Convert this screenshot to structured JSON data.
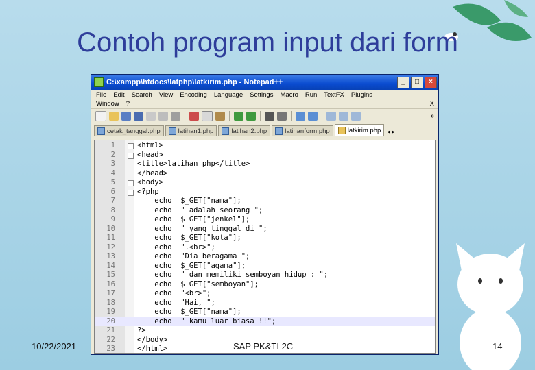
{
  "slide": {
    "title": "Contoh program input dari form",
    "footer_date": "10/22/2021",
    "footer_center": "SAP PK&TI 2C",
    "page_number": "14"
  },
  "window": {
    "title": "C:\\xampp\\htdocs\\latphp\\latkirim.php - Notepad++",
    "buttons": [
      "_",
      "□",
      "×"
    ]
  },
  "menu": {
    "row1": [
      "File",
      "Edit",
      "Search",
      "View",
      "Encoding",
      "Language",
      "Settings",
      "Macro",
      "Run",
      "TextFX",
      "Plugins"
    ],
    "row2": [
      "Window",
      "?"
    ],
    "close": "X",
    "more": "»"
  },
  "tabs": [
    {
      "label": "cetak_tanggal.php",
      "active": false
    },
    {
      "label": "latihan1.php",
      "active": false
    },
    {
      "label": "latihan2.php",
      "active": false
    },
    {
      "label": "latihanform.php",
      "active": false
    },
    {
      "label": "latkirim.php",
      "active": true
    }
  ],
  "tab_arrows": "◂ ▸",
  "code_lines": [
    {
      "n": "1",
      "text": "<html>"
    },
    {
      "n": "2",
      "text": "<head>"
    },
    {
      "n": "3",
      "text": "<title>latihan php</title>"
    },
    {
      "n": "4",
      "text": "</head>"
    },
    {
      "n": "5",
      "text": "<body>"
    },
    {
      "n": "6",
      "text": "<?php"
    },
    {
      "n": "7",
      "text": "    echo  $_GET[\"nama\"];"
    },
    {
      "n": "8",
      "text": "    echo  \" adalah seorang \";"
    },
    {
      "n": "9",
      "text": "    echo  $_GET[\"jenkel\"];"
    },
    {
      "n": "10",
      "text": "    echo  \" yang tinggal di \";"
    },
    {
      "n": "11",
      "text": "    echo  $_GET[\"kota\"];"
    },
    {
      "n": "12",
      "text": "    echo  \".<br>\";"
    },
    {
      "n": "13",
      "text": "    echo  \"Dia beragama \";"
    },
    {
      "n": "14",
      "text": "    echo  $_GET[\"agama\"];"
    },
    {
      "n": "15",
      "text": "    echo  \" dan memiliki semboyan hidup : \";"
    },
    {
      "n": "16",
      "text": "    echo  $_GET[\"semboyan\"];"
    },
    {
      "n": "17",
      "text": "    echo  \"<br>\";"
    },
    {
      "n": "18",
      "text": "    echo  \"Hai, \";"
    },
    {
      "n": "19",
      "text": "    echo  $_GET[\"nama\"];"
    },
    {
      "n": "20",
      "text": "    echo  \" kamu luar biasa !!\";"
    },
    {
      "n": "21",
      "text": "?>"
    },
    {
      "n": "22",
      "text": "</body>"
    },
    {
      "n": "23",
      "text": "</html>"
    }
  ],
  "highlight_line": 20,
  "colors": {
    "title": "#2e3d9a",
    "titlebar": "#0a4bd0"
  }
}
